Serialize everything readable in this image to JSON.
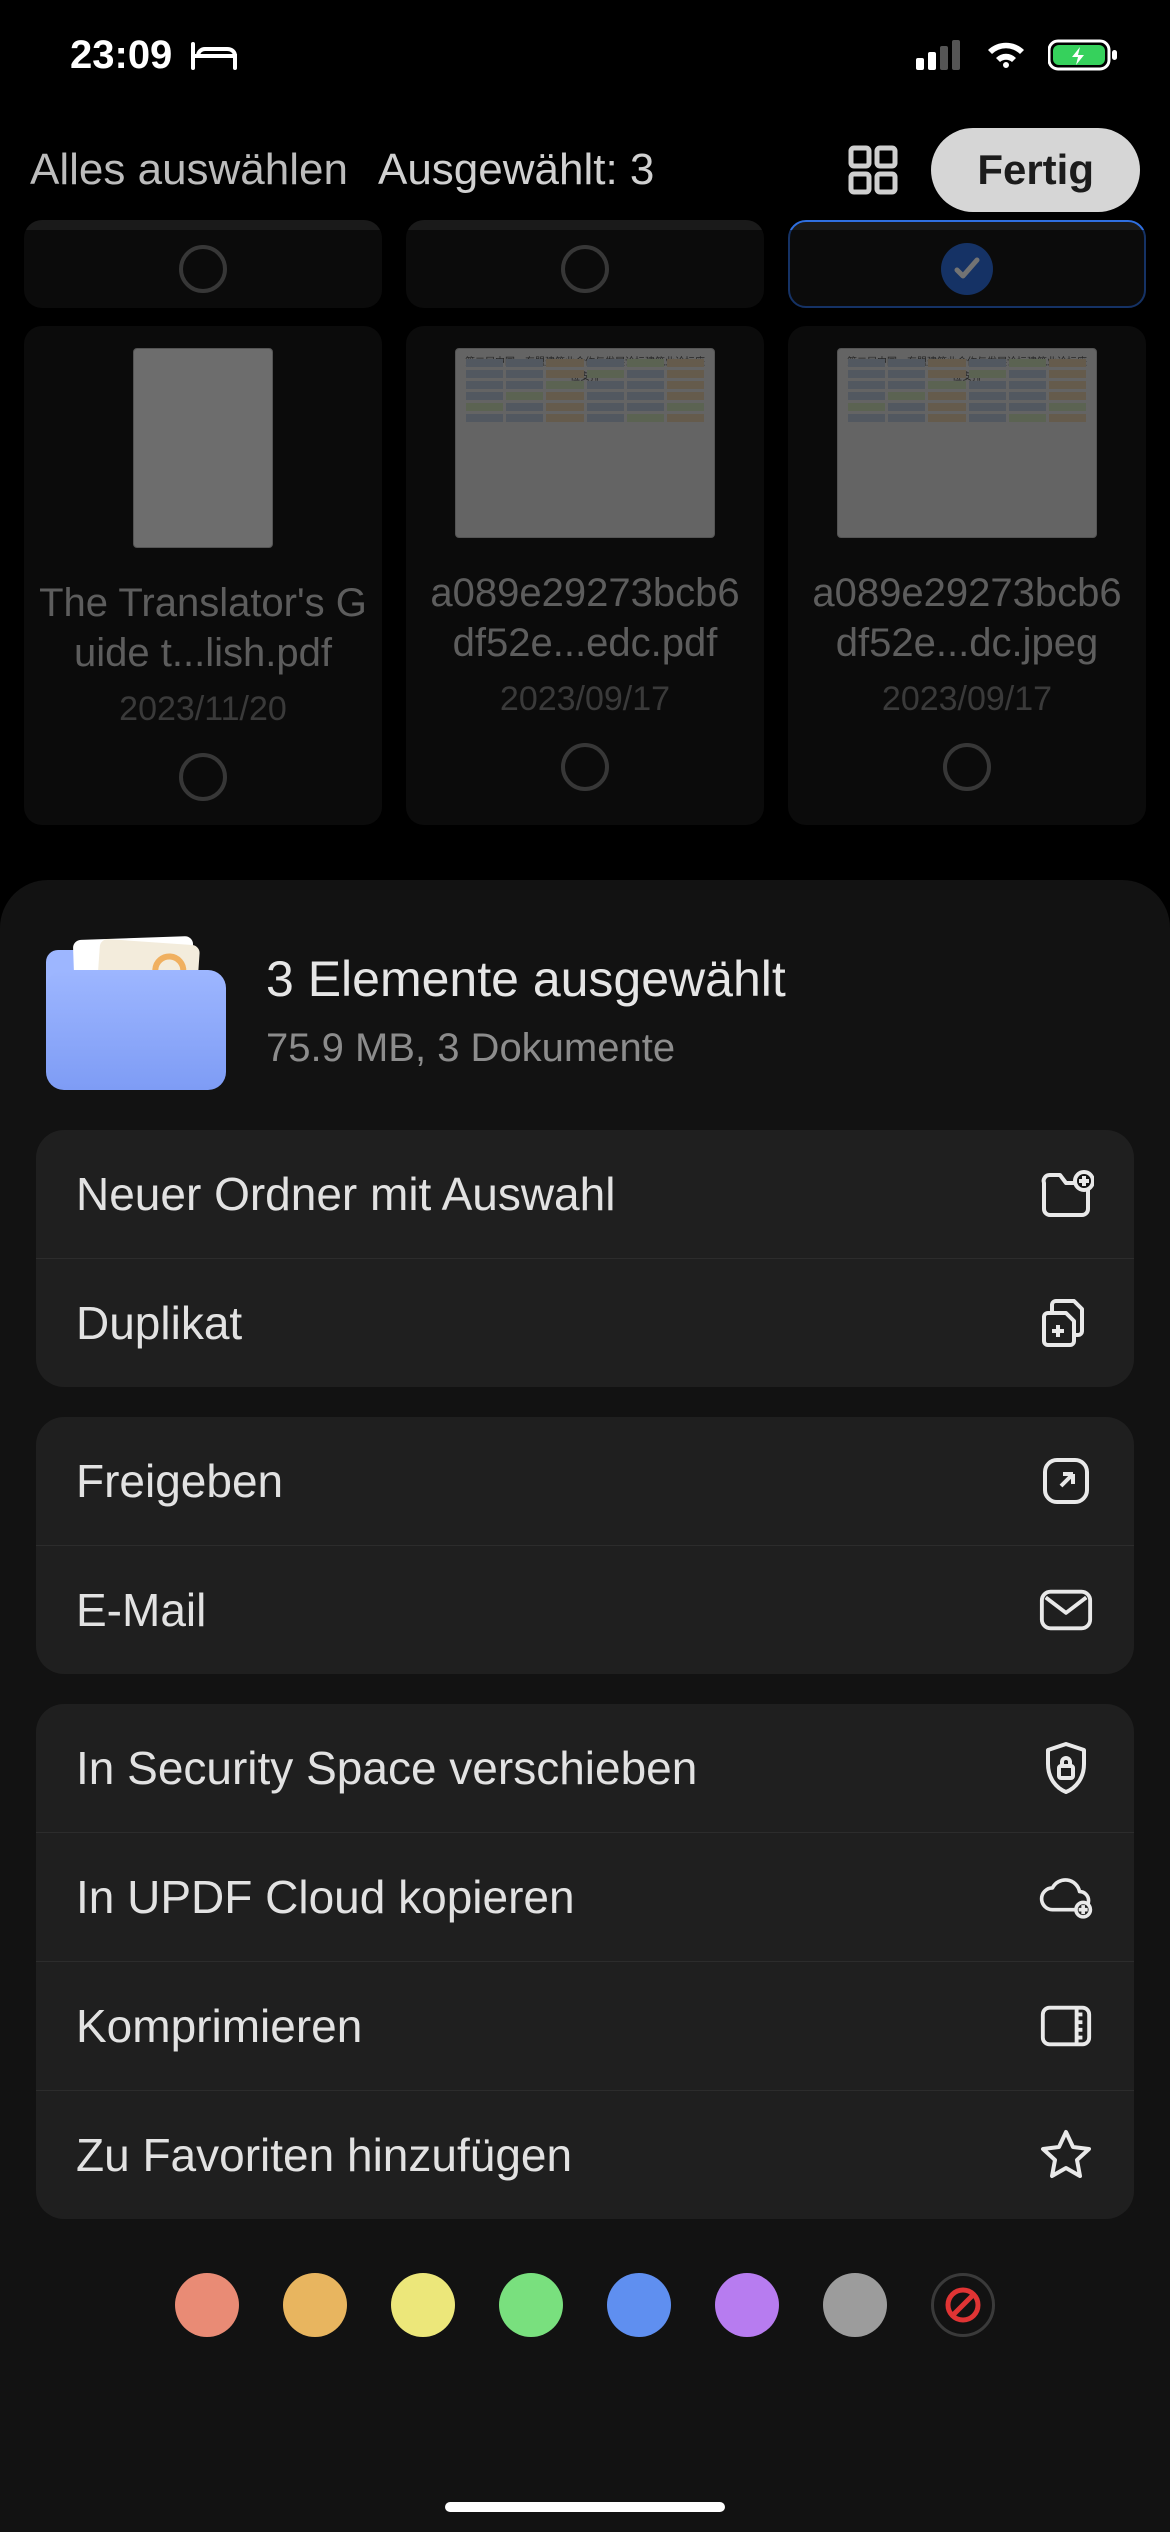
{
  "status": {
    "time": "23:09"
  },
  "toolbar": {
    "select_all": "Alles auswählen",
    "selected_label": "Ausgewählt: 3",
    "done": "Fertig"
  },
  "files": [
    {
      "name": "The Translator's Guide t...lish.pdf",
      "date": "2023/11/20"
    },
    {
      "name": "a089e29273bcb6df52e...edc.pdf",
      "date": "2023/09/17"
    },
    {
      "name": "a089e29273bcb6df52e...dc.jpeg",
      "date": "2023/09/17"
    }
  ],
  "sheet": {
    "title": "3 Elemente ausgewählt",
    "subtitle": "75.9 MB, 3 Dokumente",
    "actions": {
      "new_folder": "Neuer Ordner mit Auswahl",
      "duplicate": "Duplikat",
      "share": "Freigeben",
      "email": "E-Mail",
      "security": "In Security Space verschieben",
      "cloud": "In UPDF Cloud kopieren",
      "compress": "Komprimieren",
      "favorite": "Zu Favoriten hinzufügen"
    }
  },
  "colors": [
    "#e98b75",
    "#e8b55f",
    "#ece77a",
    "#79e07e",
    "#5f8ff0",
    "#b77cf0",
    "#9c9c9c"
  ]
}
